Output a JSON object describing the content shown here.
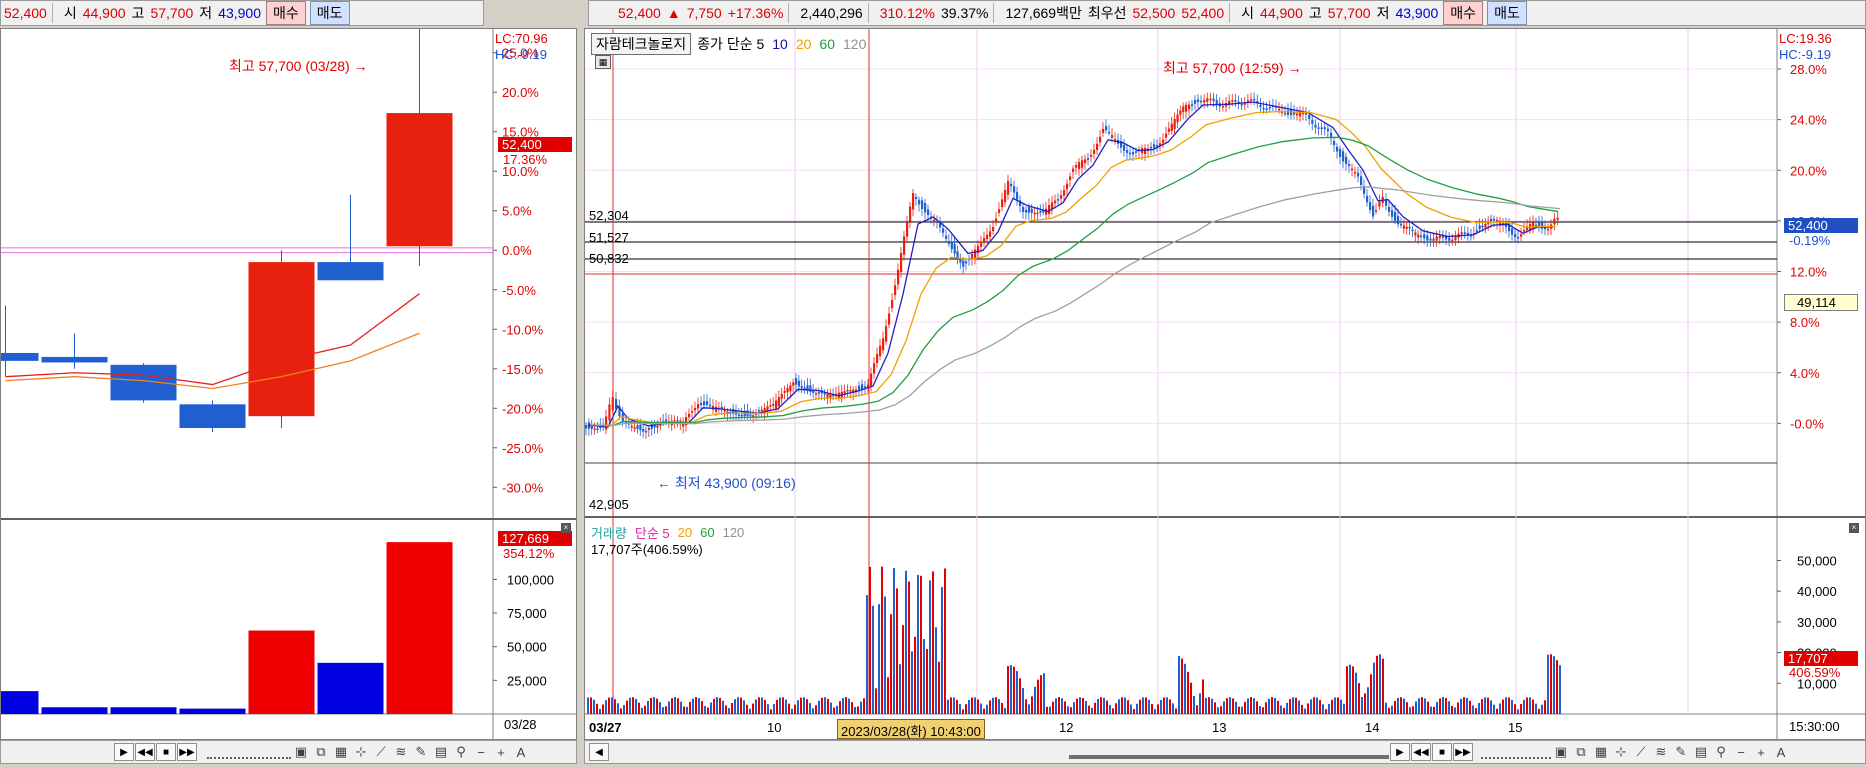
{
  "left": {
    "topbar": {
      "price": "52,400",
      "open_label": "시",
      "open": "44,900",
      "high_label": "고",
      "high": "57,700",
      "low_label": "저",
      "low": "43,900",
      "buy": "매수",
      "sell": "매도"
    },
    "lc": "LC:70.96",
    "hc": "HC:-9.19",
    "high_annot": "최고 57,700 (03/28)",
    "price_tag": "52,400",
    "pct_tag": "17.36%",
    "vol_tag": "127,669",
    "vol_pct_tag": "354.12%",
    "date_label": "03/28"
  },
  "right": {
    "topbar": {
      "price": "52,400",
      "change": "7,750",
      "change_pct": "+17.36%",
      "volume": "2,440,296",
      "vol_ratio": "310.12%",
      "turnover": "39.37%",
      "amount": "127,669백만",
      "best_label": "최우선",
      "best_ask": "52,500",
      "best_bid": "52,400",
      "open_label": "시",
      "open": "44,900",
      "high_label": "고",
      "high": "57,700",
      "low_label": "저",
      "low": "43,900",
      "buy": "매수",
      "sell": "매도"
    },
    "stock_name": "자람테크놀로지",
    "ma_legend": {
      "label": "종가 단순 5",
      "p10": "10",
      "p20": "20",
      "p60": "60",
      "p120": "120"
    },
    "lc": "LC:19.36",
    "hc": "HC:-9.19",
    "high_annot": "최고 57,700 (12:59)",
    "low_annot": "최저 43,900 (09:16)",
    "price_tag": "52,400",
    "pct_tag": "-0.19%",
    "line_tag": "49,114",
    "hlines": [
      "52,304",
      "51,527",
      "50,832"
    ],
    "bottom_price": "42,905",
    "vol_legend": {
      "label": "거래량",
      "ma": "단순 5",
      "p20": "20",
      "p60": "60",
      "p120": "120"
    },
    "vol_info": "17,707주(406.59%)",
    "vol_tag": "17,707",
    "vol_pct_tag": "406.59%",
    "crosshair_date": "2023/03/28(화) 10:43:00",
    "x_labels": [
      "03/27",
      "10",
      "12",
      "13",
      "14",
      "15"
    ],
    "time_label": "15:30:00"
  },
  "colors": {
    "up": "#e8210f",
    "down": "#1f5fd0",
    "ma5": "#2020c0",
    "ma10": "#1010a0",
    "ma20": "#f0a000",
    "ma60": "#20a040",
    "ma120": "#a0a0a0"
  },
  "chart_data": [
    {
      "type": "candlestick",
      "title": "",
      "y_axis_pct_ticks": [
        "25.0%",
        "20.0%",
        "15.0%",
        "10.0%",
        "5.0%",
        "0.0%",
        "-5.0%",
        "-10.0%",
        "-15.0%",
        "-20.0%",
        "-25.0%",
        "-30.0%"
      ],
      "ylim_pct": [
        -33,
        28
      ],
      "candles_pct": [
        {
          "open": -13.0,
          "close": -14.0,
          "high": -7.0,
          "low": -16.0
        },
        {
          "open": -13.5,
          "close": -14.2,
          "high": -10.5,
          "low": -15.0
        },
        {
          "open": -14.5,
          "close": -19.0,
          "high": -14.3,
          "low": -19.3
        },
        {
          "open": -19.5,
          "close": -22.5,
          "high": -19.0,
          "low": -23.0
        },
        {
          "open": -21.0,
          "close": -1.5,
          "high": 0.0,
          "low": -22.5
        },
        {
          "open": -1.5,
          "close": -3.8,
          "high": 7.0,
          "low": -3.8
        },
        {
          "open": 0.5,
          "close": 17.36,
          "high": 29.0,
          "low": -2.0
        }
      ],
      "ma_lines": [
        {
          "name": "5",
          "values": [
            -16,
            -15.5,
            -15.8,
            -17,
            -14,
            -12,
            -5.5
          ]
        },
        {
          "name": "10",
          "values": [
            -16.5,
            -16,
            -16.5,
            -17.5,
            -16,
            -14,
            -10.5
          ]
        }
      ],
      "volume_ticks": [
        "100,000",
        "75,000",
        "50,000",
        "25,000"
      ],
      "volume_ylim": [
        0,
        130000
      ],
      "volumes": [
        17000,
        5000,
        5000,
        4000,
        62000,
        38000,
        127669
      ]
    },
    {
      "type": "candlestick",
      "title": "",
      "y_axis_pct_ticks": [
        "28.0%",
        "24.0%",
        "20.0%",
        "16.0%",
        "12.0%",
        "8.0%",
        "4.0%",
        "-0.0%"
      ],
      "ylim_pct": [
        -4,
        30
      ],
      "x_day_labels": [
        "03/27",
        "10",
        "12",
        "13",
        "14",
        "15"
      ],
      "volume_ticks": [
        "50,000",
        "40,000",
        "30,000",
        "20,000",
        "10,000"
      ],
      "volume_ylim": [
        0,
        57000
      ]
    }
  ]
}
